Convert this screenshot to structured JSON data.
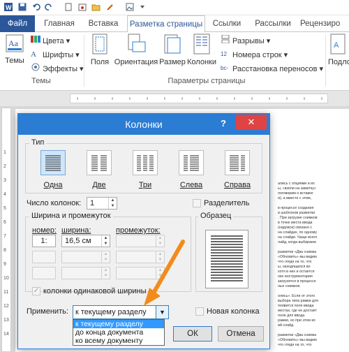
{
  "tabs": [
    "Файл",
    "Главная",
    "Вставка",
    "Разметка страницы",
    "Ссылки",
    "Рассылки",
    "Рецензиро"
  ],
  "ribbon": {
    "themes_button": "Темы",
    "colors": "Цвета",
    "fonts": "Шрифты",
    "effects": "Эффекты",
    "themes_group": "Темы",
    "margins": "Поля",
    "orientation": "Ориентация",
    "size": "Размер",
    "columns": "Колонки",
    "breaks": "Разрывы",
    "line_numbers": "Номера строк",
    "hyphenation": "Расстановка переносов",
    "page_setup_group": "Параметры страницы",
    "background_cut": "Подло"
  },
  "ruler_marks": [
    "1",
    "2",
    "3",
    "4",
    "5",
    "6",
    "7",
    "8",
    "9",
    "10",
    "11",
    "12",
    "13",
    "14"
  ],
  "document_text": [
    "ались с опциями и их",
    "ы, «взяли на заметку»",
    "поговорим о вставке",
    "и), а вместе с этим,",
    "",
    "в процессе создания",
    "и шаблонов разметки",
    ". При загрузке снимков",
    "в точке места ввода",
    "(надписи) связано с",
    "на слайдах, по одному",
    "на слайде. Чаще всего",
    "лайд, когда выбираем",
    "",
    "разметки «Два снимка",
    "«Обновить» мы видим",
    "что глядя на то, что",
    "ы, находящихся во",
    "хотя в них и остается",
    "оке инструментария",
    "загрузятся в процессе",
    "ных снимков.",
    "",
    "олись». Если от этого",
    "выбора типа рамки для",
    "появится поле ввода",
    "местах, где не достаёт",
    "поле для ввода",
    "рамки, но при этом их",
    "ий слайд.",
    "",
    "разметки «Два снимка",
    "«Обновить» мы видим",
    "что глядя на то, что"
  ],
  "dialog": {
    "title": "Колонки",
    "help": "?",
    "close": "✕",
    "type_legend": "Тип",
    "presets": [
      "Одна",
      "Две",
      "Три",
      "Слева",
      "Справа"
    ],
    "selected_preset": "Одна",
    "num_columns_label": "Число колонок:",
    "num_columns_value": "1",
    "separator_label": "Разделитель",
    "width_legend": "Ширина и промежуток",
    "sample_legend": "Образец",
    "col_number_header": "номер:",
    "width_header": "ширина:",
    "spacing_header": "промежуток:",
    "row1_number": "1:",
    "row1_width": "16,5 см",
    "equal_width_label": "колонки одинаковой ширины",
    "apply_label": "Применить:",
    "apply_value": "к текущему разделу",
    "apply_options": [
      "к текущему разделу",
      "до конца документа",
      "ко всему документу"
    ],
    "new_column_label": "Новая колонка",
    "ok": "ОК",
    "cancel": "Отмена"
  },
  "colors": {
    "accent": "#2b579a",
    "dialog_title": "#2b7cd3",
    "close": "#e04343",
    "annotation_arrow": "#f28b1c",
    "selection": "#3399ff"
  }
}
